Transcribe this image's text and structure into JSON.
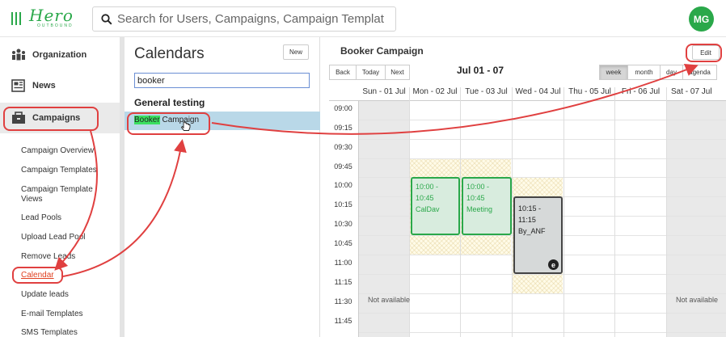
{
  "app": {
    "logo_word": "Hero",
    "logo_sub": "OUTBOUND",
    "avatar_initials": "MG",
    "accent": "#2aa84a"
  },
  "search": {
    "placeholder": "Search for Users, Campaigns, Campaign Templates"
  },
  "nav": {
    "main": [
      {
        "label": "Organization",
        "icon": "organization-icon"
      },
      {
        "label": "News",
        "icon": "news-icon"
      },
      {
        "label": "Campaigns",
        "icon": "campaigns-icon"
      }
    ],
    "sub": [
      "Campaign Overview",
      "Campaign Templates",
      "Campaign Template Views",
      "Lead Pools",
      "Upload Lead Pool",
      "Remove Leads",
      "Calendar",
      "Update leads",
      "E-mail Templates",
      "SMS Templates"
    ],
    "active_sub": "Calendar"
  },
  "calendars": {
    "title": "Calendars",
    "new_label": "New",
    "filter_value": "booker",
    "group": "General testing",
    "items": [
      {
        "highlight": "Booker",
        "rest": " Campaign"
      }
    ]
  },
  "main": {
    "title": "Booker Campaign",
    "edit_label": "Edit",
    "range": "Jul 01 - 07",
    "nav_buttons": [
      "Back",
      "Today",
      "Next"
    ],
    "view_buttons": [
      "week",
      "month",
      "day",
      "agenda"
    ],
    "selected_view": "week",
    "days": [
      "Sun - 01 Jul",
      "Mon - 02 Jul",
      "Tue - 03 Jul",
      "Wed - 04 Jul",
      "Thu - 05 Jul",
      "Fri - 06 Jul",
      "Sat - 07 Jul"
    ],
    "times": [
      "09:00",
      "09:15",
      "09:30",
      "09:45",
      "10:00",
      "10:15",
      "10:30",
      "10:45",
      "11:00",
      "11:15",
      "11:30",
      "11:45"
    ],
    "not_available": "Not available",
    "events": [
      {
        "time": "10:00 - 10:45",
        "t1": "10:00 -",
        "t2": "10:45",
        "title": "CalDav"
      },
      {
        "time": "10:00 - 10:45",
        "t1": "10:00 -",
        "t2": "10:45",
        "title": "Meeting"
      },
      {
        "time": "10:15 - 11:15",
        "t1": "10:15 -",
        "t2": "11:15",
        "title": "By_ANF",
        "badge": "e"
      }
    ]
  }
}
